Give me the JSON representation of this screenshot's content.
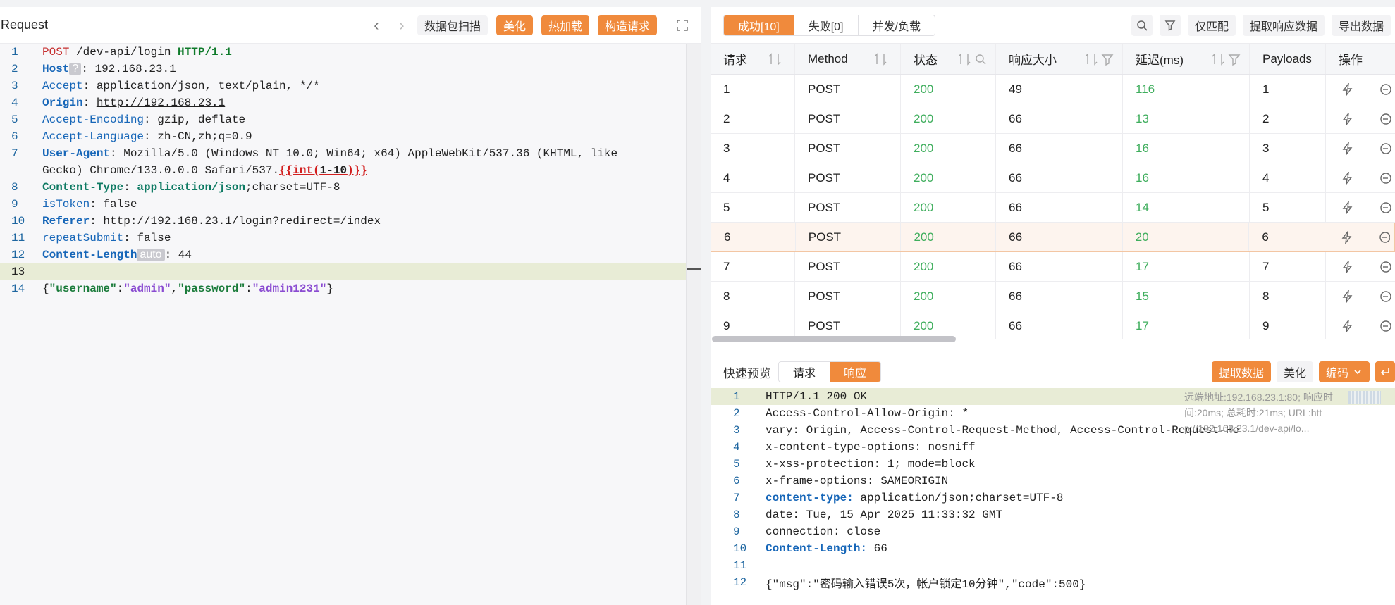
{
  "left": {
    "title": "Request",
    "toolbar": {
      "scan": "数据包扫描",
      "beautify": "美化",
      "hotload": "热加载",
      "construct": "构造请求"
    },
    "lines": [
      {
        "n": "1"
      },
      {
        "n": "2"
      },
      {
        "n": "3"
      },
      {
        "n": "4"
      },
      {
        "n": "5"
      },
      {
        "n": "6"
      },
      {
        "n": "7"
      },
      {
        "n": "8"
      },
      {
        "n": "9"
      },
      {
        "n": "10"
      },
      {
        "n": "11"
      },
      {
        "n": "12"
      },
      {
        "n": "13"
      },
      {
        "n": "14"
      }
    ],
    "req": {
      "method": "POST",
      "path": " /dev-api/login ",
      "proto": "HTTP/1.1",
      "host_k": "Host",
      "host_chip": "?",
      "host_v": ": 192.168.23.1",
      "accept_k": "Accept",
      "accept_v": ": application/json, text/plain, */*",
      "origin_k": "Origin",
      "origin_sep": ": ",
      "origin_v": "http://192.168.23.1",
      "enc_k": "Accept-Encoding",
      "enc_v": ": gzip, deflate",
      "lang_k": "Accept-Language",
      "lang_v": ": zh-CN,zh;q=0.9",
      "ua_k": "User-Agent",
      "ua_v1": ": Mozilla/5.0 (Windows NT 10.0; Win64; x64) AppleWebKit/537.36 (KHTML, like",
      "ua_v2": "Gecko) Chrome/133.0.0.0 Safari/537.",
      "ua_tpl_open": "{{int(",
      "ua_tpl_mid": "1-10",
      "ua_tpl_close": ")}}",
      "ct_k": "Content-Type",
      "ct_sep": ": ",
      "ct_v": "application/json",
      "ct_v2": ";charset=UTF-8",
      "istoken_k": "isToken",
      "istoken_v": ": false",
      "referer_k": "Referer",
      "referer_sep": ": ",
      "referer_v": "http://192.168.23.1/login?redirect=/index",
      "repeat_k": "repeatSubmit",
      "repeat_v": ": false",
      "cl_k": "Content-Length",
      "cl_chip": "auto",
      "cl_v": ": 44",
      "body_open": "{",
      "body_k1": "\"username\"",
      "body_c1": ":",
      "body_v1": "\"admin\"",
      "body_comma": ",",
      "body_k2": "\"password\"",
      "body_c2": ":",
      "body_v2": "\"admin1231\"",
      "body_close": "}"
    }
  },
  "right": {
    "tabs": {
      "success": "成功[10]",
      "fail": "失败[0]",
      "concurrency": "并发/负载"
    },
    "tools": {
      "only_match": "仅匹配",
      "extract": "提取响应数据",
      "export": "导出数据"
    },
    "headers": {
      "req": "请求",
      "method": "Method",
      "status": "状态",
      "size": "响应大小",
      "delay": "延迟(ms)",
      "payloads": "Payloads",
      "ops": "操作"
    },
    "rows": [
      {
        "req": "1",
        "method": "POST",
        "status": "200",
        "size": "49",
        "delay": "116",
        "payload": "1"
      },
      {
        "req": "2",
        "method": "POST",
        "status": "200",
        "size": "66",
        "delay": "13",
        "payload": "2"
      },
      {
        "req": "3",
        "method": "POST",
        "status": "200",
        "size": "66",
        "delay": "16",
        "payload": "3"
      },
      {
        "req": "4",
        "method": "POST",
        "status": "200",
        "size": "66",
        "delay": "16",
        "payload": "4"
      },
      {
        "req": "5",
        "method": "POST",
        "status": "200",
        "size": "66",
        "delay": "14",
        "payload": "5"
      },
      {
        "req": "6",
        "method": "POST",
        "status": "200",
        "size": "66",
        "delay": "20",
        "payload": "6"
      },
      {
        "req": "7",
        "method": "POST",
        "status": "200",
        "size": "66",
        "delay": "17",
        "payload": "7"
      },
      {
        "req": "8",
        "method": "POST",
        "status": "200",
        "size": "66",
        "delay": "15",
        "payload": "8"
      },
      {
        "req": "9",
        "method": "POST",
        "status": "200",
        "size": "66",
        "delay": "17",
        "payload": "9"
      }
    ],
    "preview": {
      "label": "快速预览",
      "tab_req": "请求",
      "tab_resp": "响应",
      "extract": "提取数据",
      "beautify": "美化",
      "encoding": "编码",
      "meta1": "远端地址:192.168.23.1:80; 响应时",
      "meta2": "间:20ms; 总耗时:21ms; URL:htt",
      "meta3": "p://192.168.23.1/dev-api/lo...",
      "lines": [
        {
          "n": "1",
          "t": "HTTP/1.1 200 OK"
        },
        {
          "n": "2",
          "t": "Access-Control-Allow-Origin: *"
        },
        {
          "n": "3",
          "t": "vary: Origin, Access-Control-Request-Method, Access-Control-Request-He"
        },
        {
          "n": "4",
          "t": "x-content-type-options: nosniff"
        },
        {
          "n": "5",
          "t": "x-xss-protection: 1; mode=block"
        },
        {
          "n": "6",
          "t": "x-frame-options: SAMEORIGIN"
        },
        {
          "n": "7",
          "k": "content-type:",
          "t": " application/json;charset=UTF-8"
        },
        {
          "n": "8",
          "t": "date: Tue, 15 Apr 2025 11:33:32 GMT"
        },
        {
          "n": "9",
          "t": "connection: close"
        },
        {
          "n": "10",
          "k": "Content-Length:",
          "t": " 66"
        },
        {
          "n": "11",
          "t": ""
        },
        {
          "n": "12",
          "t": "{\"msg\":\"密码输入错误5次，帐户锁定10分钟\",\"code\":500}"
        }
      ]
    },
    "colors": {
      "accent": "#f08a3c",
      "status_ok": "#3fae5d"
    }
  }
}
